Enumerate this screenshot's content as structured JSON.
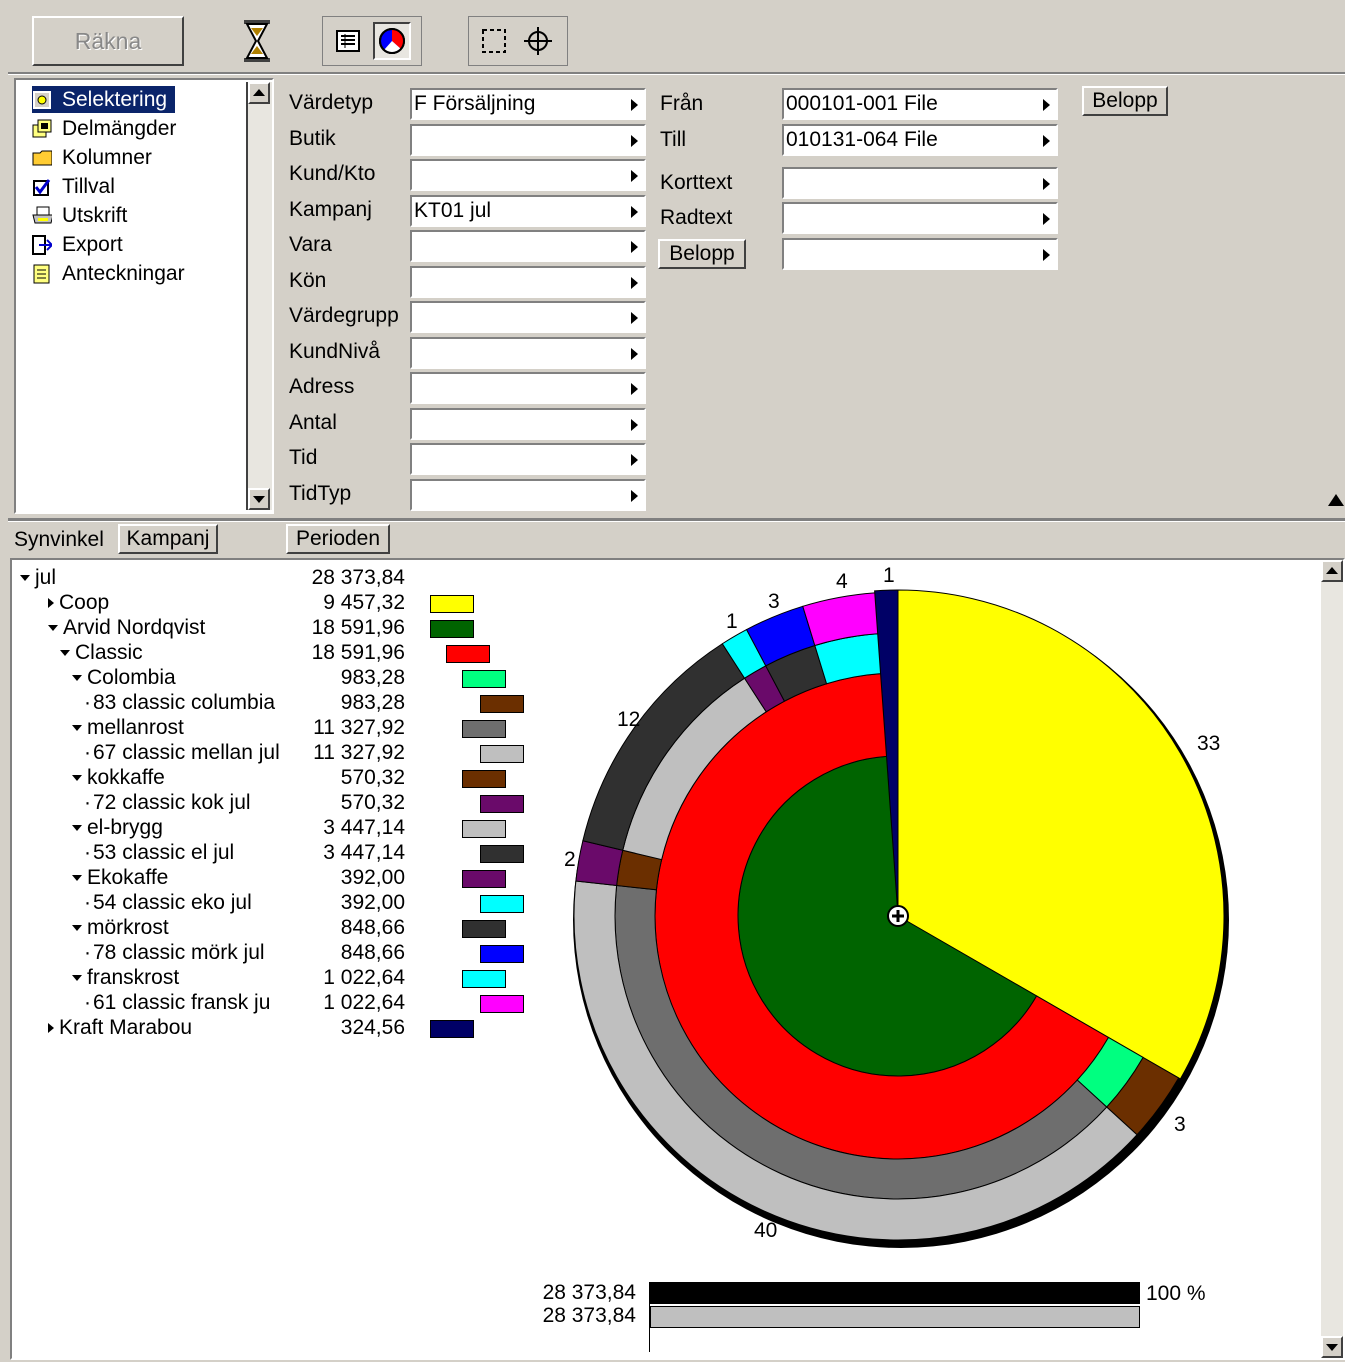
{
  "toolbar": {
    "rakna_label": "Räkna"
  },
  "nav": {
    "items": [
      {
        "label": "Selektering",
        "icon": "selection-icon"
      },
      {
        "label": "Delmängder",
        "icon": "subsets-icon"
      },
      {
        "label": "Kolumner",
        "icon": "folder-icon"
      },
      {
        "label": "Tillval",
        "icon": "checkbox-icon"
      },
      {
        "label": "Utskrift",
        "icon": "printer-icon"
      },
      {
        "label": "Export",
        "icon": "export-icon"
      },
      {
        "label": "Anteckningar",
        "icon": "notes-icon"
      }
    ],
    "selected_index": 0
  },
  "filters": {
    "left": [
      {
        "label": "Värdetyp",
        "value": "F Försäljning"
      },
      {
        "label": "Butik",
        "value": ""
      },
      {
        "label": "Kund/Kto",
        "value": ""
      },
      {
        "label": "Kampanj",
        "value": "KT01  jul"
      },
      {
        "label": "Vara",
        "value": ""
      },
      {
        "label": "Kön",
        "value": ""
      },
      {
        "label": "Värdegrupp",
        "value": ""
      },
      {
        "label": "KundNivå",
        "value": ""
      },
      {
        "label": "Adress",
        "value": ""
      },
      {
        "label": "Antal",
        "value": ""
      },
      {
        "label": "Tid",
        "value": ""
      },
      {
        "label": "TidTyp",
        "value": ""
      }
    ],
    "fran_label": "Från",
    "fran_value": "000101-001 File",
    "till_label": "Till",
    "till_value": "010131-064 File",
    "belopp_button": "Belopp",
    "korttext_label": "Korttext",
    "korttext_value": "",
    "radtext_label": "Radtext",
    "radtext_value": "",
    "belopp_label_button": "Belopp",
    "belopp_value": ""
  },
  "view": {
    "synvinkel_label": "Synvinkel",
    "synvinkel_button": "Kampanj",
    "perioden_button": "Perioden"
  },
  "tree": [
    {
      "label": "jul",
      "value": "28 373,84",
      "indent": 0,
      "toggle": "expanded",
      "color": null
    },
    {
      "label": "Coop",
      "value": "9 457,32",
      "indent": 1,
      "toggle": "collapsed",
      "color": "#ffff00"
    },
    {
      "label": "Arvid Nordqvist",
      "value": "18 591,96",
      "indent": 1,
      "toggle": "expanded",
      "color": "#006400"
    },
    {
      "label": "Classic",
      "value": "18 591,96",
      "indent": 2,
      "toggle": "expanded",
      "color": "#ff0000"
    },
    {
      "label": "Colombia",
      "value": "983,28",
      "indent": 3,
      "toggle": "expanded",
      "color": "#00ff80"
    },
    {
      "label": "83 classic columbia",
      "value": "983,28",
      "indent": 4,
      "toggle": "leaf",
      "color": "#6b2f00"
    },
    {
      "label": "mellanrost",
      "value": "11 327,92",
      "indent": 3,
      "toggle": "expanded",
      "color": "#6e6e6e"
    },
    {
      "label": "67 classic mellan jul",
      "value": "11 327,92",
      "indent": 4,
      "toggle": "leaf",
      "color": "#bfbfbf"
    },
    {
      "label": "kokkaffe",
      "value": "570,32",
      "indent": 3,
      "toggle": "expanded",
      "color": "#6b2f00"
    },
    {
      "label": "72 classic kok jul",
      "value": "570,32",
      "indent": 4,
      "toggle": "leaf",
      "color": "#6a0a6a"
    },
    {
      "label": "el-brygg",
      "value": "3 447,14",
      "indent": 3,
      "toggle": "expanded",
      "color": "#bfbfbf"
    },
    {
      "label": "53 classic el jul",
      "value": "3 447,14",
      "indent": 4,
      "toggle": "leaf",
      "color": "#303030"
    },
    {
      "label": "Ekokaffe",
      "value": "392,00",
      "indent": 3,
      "toggle": "expanded",
      "color": "#6a0a6a"
    },
    {
      "label": "54 classic eko jul",
      "value": "392,00",
      "indent": 4,
      "toggle": "leaf",
      "color": "#00ffff"
    },
    {
      "label": "mörkrost",
      "value": "848,66",
      "indent": 3,
      "toggle": "expanded",
      "color": "#303030"
    },
    {
      "label": "78 classic mörk jul",
      "value": "848,66",
      "indent": 4,
      "toggle": "leaf",
      "color": "#0000ff"
    },
    {
      "label": "franskrost",
      "value": "1 022,64",
      "indent": 3,
      "toggle": "expanded",
      "color": "#00ffff"
    },
    {
      "label": "61 classic fransk ju",
      "value": "1 022,64",
      "indent": 4,
      "toggle": "leaf",
      "color": "#ff00ff"
    },
    {
      "label": "Kraft Marabou",
      "value": "324,56",
      "indent": 1,
      "toggle": "collapsed",
      "color": "#000066"
    }
  ],
  "chart_data": {
    "type": "pie",
    "title": "",
    "level1": [
      {
        "name": "Coop",
        "value": 9457.32,
        "color": "#ffff00"
      },
      {
        "name": "Arvid Nordqvist",
        "value": 18591.96,
        "color": "#006400"
      },
      {
        "name": "Kraft Marabou",
        "value": 324.56,
        "color": "#000066"
      }
    ],
    "level2": [
      {
        "name": "Classic",
        "value": 18591.96,
        "color": "#ff0000"
      }
    ],
    "level3": [
      {
        "name": "Colombia",
        "value": 983.28,
        "color": "#00ff80"
      },
      {
        "name": "mellanrost",
        "value": 11327.92,
        "color": "#6e6e6e"
      },
      {
        "name": "kokkaffe",
        "value": 570.32,
        "color": "#6b2f00"
      },
      {
        "name": "el-brygg",
        "value": 3447.14,
        "color": "#bfbfbf"
      },
      {
        "name": "Ekokaffe",
        "value": 392.0,
        "color": "#6a0a6a"
      },
      {
        "name": "mörkrost",
        "value": 848.66,
        "color": "#303030"
      },
      {
        "name": "franskrost",
        "value": 1022.64,
        "color": "#00ffff"
      }
    ],
    "level4": [
      {
        "name": "83 classic columbia",
        "value": 983.28,
        "color": "#6b2f00"
      },
      {
        "name": "67 classic mellan jul",
        "value": 11327.92,
        "color": "#bfbfbf"
      },
      {
        "name": "72 classic kok jul",
        "value": 570.32,
        "color": "#6a0a6a"
      },
      {
        "name": "53 classic el jul",
        "value": 3447.14,
        "color": "#303030"
      },
      {
        "name": "54 classic eko jul",
        "value": 392.0,
        "color": "#00ffff"
      },
      {
        "name": "78 classic mörk jul",
        "value": 848.66,
        "color": "#0000ff"
      },
      {
        "name": "61 classic fransk ju",
        "value": 1022.64,
        "color": "#ff00ff"
      }
    ],
    "percent_labels": [
      "33",
      "3",
      "40",
      "2",
      "12",
      "1",
      "3",
      "4",
      "1"
    ],
    "total_bar": {
      "value_top": "28 373,84",
      "value_bottom": "28 373,84",
      "percent": "100 %",
      "fraction_top": 1.0,
      "fraction_bottom": 1.0
    }
  }
}
